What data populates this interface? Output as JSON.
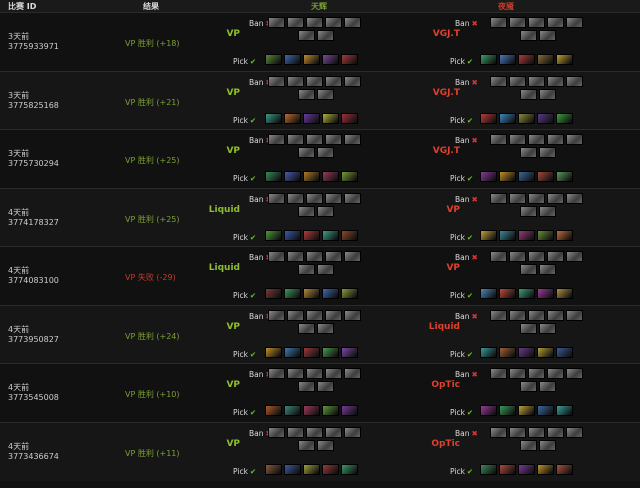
{
  "header": {
    "match_id": "比赛 ID",
    "result": "结果",
    "radiant": "天辉",
    "dire": "夜魇"
  },
  "labels": {
    "ban": "Ban",
    "pick": "Pick",
    "ban_mark": "✖",
    "pick_mark": "✔"
  },
  "matches": [
    {
      "age": "3天前",
      "id": "3775933971",
      "result": "VP 胜利 (+18)",
      "won": true,
      "radiant": "VP",
      "dire": "VGJ.T",
      "rp": [
        "#5a8a3a",
        "#3a6ab0",
        "#c08a30",
        "#7a4a9a",
        "#a83a3a"
      ],
      "dp": [
        "#3aa06a",
        "#4a7ac0",
        "#b03a3a",
        "#8a6a3a",
        "#c0a030"
      ]
    },
    {
      "age": "3天前",
      "id": "3775825168",
      "result": "VP 胜利 (+21)",
      "won": true,
      "radiant": "VP",
      "dire": "VGJ.T",
      "rp": [
        "#3a9a8a",
        "#c06a2a",
        "#6a3aa0",
        "#b0b03a",
        "#a0303a"
      ],
      "dp": [
        "#c03a3a",
        "#3a8ac0",
        "#8a8a3a",
        "#5a3a8a",
        "#3aa03a"
      ]
    },
    {
      "age": "3天前",
      "id": "3775730294",
      "result": "VP 胜利 (+25)",
      "won": true,
      "radiant": "VP",
      "dire": "VGJ.T",
      "rp": [
        "#3a8a5a",
        "#4a5ab0",
        "#b07a2a",
        "#9a3a5a",
        "#7a9a3a"
      ],
      "dp": [
        "#8a3a9a",
        "#c0902a",
        "#3a6a9a",
        "#a04a3a",
        "#5a9a5a"
      ]
    },
    {
      "age": "4天前",
      "id": "3774178327",
      "result": "VP 胜利 (+25)",
      "won": true,
      "radiant": "Liquid",
      "dire": "VP",
      "rp": [
        "#4a9a3a",
        "#3a5ab0",
        "#b03a3a",
        "#3aa08a",
        "#8a4a2a"
      ],
      "dp": [
        "#c0a03a",
        "#3a8a9a",
        "#9a3a7a",
        "#6a8a3a",
        "#c06a3a"
      ]
    },
    {
      "age": "4天前",
      "id": "3774083100",
      "result": "VP 失败 (-29)",
      "won": false,
      "radiant": "Liquid",
      "dire": "VP",
      "rp": [
        "#7a3a3a",
        "#3a9a5a",
        "#b08a3a",
        "#3a6ab0",
        "#8a9a3a"
      ],
      "dp": [
        "#4a8ac0",
        "#c04a3a",
        "#3aa07a",
        "#a03a9a",
        "#b0903a"
      ]
    },
    {
      "age": "4天前",
      "id": "3773950827",
      "result": "VP 胜利 (+24)",
      "won": true,
      "radiant": "VP",
      "dire": "Liquid",
      "rp": [
        "#c0902a",
        "#3a7ab0",
        "#9a3a3a",
        "#4a9a4a",
        "#7a4aa0"
      ],
      "dp": [
        "#3a9a9a",
        "#a0603a",
        "#6a3a8a",
        "#b0a03a",
        "#3a5a9a"
      ]
    },
    {
      "age": "4天前",
      "id": "3773545008",
      "result": "VP 胜利 (+10)",
      "won": true,
      "radiant": "VP",
      "dire": "OpTic",
      "rp": [
        "#b05a2a",
        "#3a8a7a",
        "#a03a5a",
        "#5a9a3a",
        "#7a3a9a"
      ],
      "dp": [
        "#9a3a9a",
        "#3a9a5a",
        "#c0a03a",
        "#3a6aa0",
        "#3aa0a0"
      ]
    },
    {
      "age": "4天前",
      "id": "3773436674",
      "result": "VP 胜利 (+11)",
      "won": true,
      "radiant": "VP",
      "dire": "OpTic",
      "rp": [
        "#8a5a3a",
        "#3a5aa0",
        "#a0a03a",
        "#9a3a3a",
        "#3a9a6a"
      ],
      "dp": [
        "#3a8a5a",
        "#b04a3a",
        "#7a3a9a",
        "#c0902a",
        "#b0503a"
      ]
    }
  ]
}
